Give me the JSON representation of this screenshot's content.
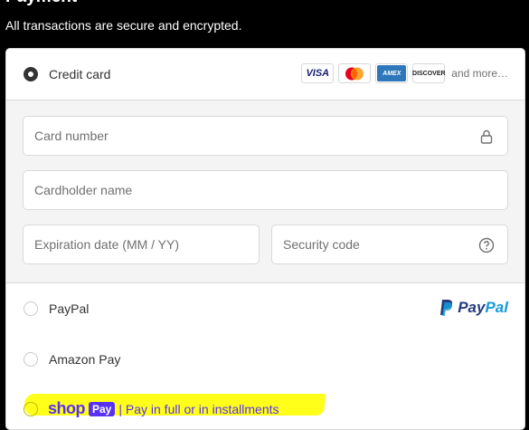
{
  "header": {
    "title": "Payment",
    "subtitle": "All transactions are secure and encrypted."
  },
  "credit_card": {
    "label": "Credit card",
    "selected": true,
    "badges": [
      "VISA",
      "",
      "AMEX",
      "DISCOVER"
    ],
    "more": "and more…"
  },
  "fields": {
    "card_number": {
      "placeholder": "Card number",
      "value": ""
    },
    "cardholder_name": {
      "placeholder": "Cardholder name",
      "value": ""
    },
    "expiration": {
      "placeholder": "Expiration date (MM / YY)",
      "value": ""
    },
    "security_code": {
      "placeholder": "Security code",
      "value": ""
    }
  },
  "options": {
    "paypal": {
      "label": "PayPal",
      "logo_pay": "Pay",
      "logo_pal": "Pal"
    },
    "amazon": {
      "label": "Amazon Pay"
    },
    "shop": {
      "word": "shop",
      "pay": "Pay",
      "text": "| Pay in full or in installments"
    }
  },
  "colors": {
    "accent": "#333333",
    "shop_purple": "#5a31f4",
    "paypal_dark": "#253b80",
    "paypal_light": "#179bd7",
    "highlight": "#ffff1a"
  }
}
